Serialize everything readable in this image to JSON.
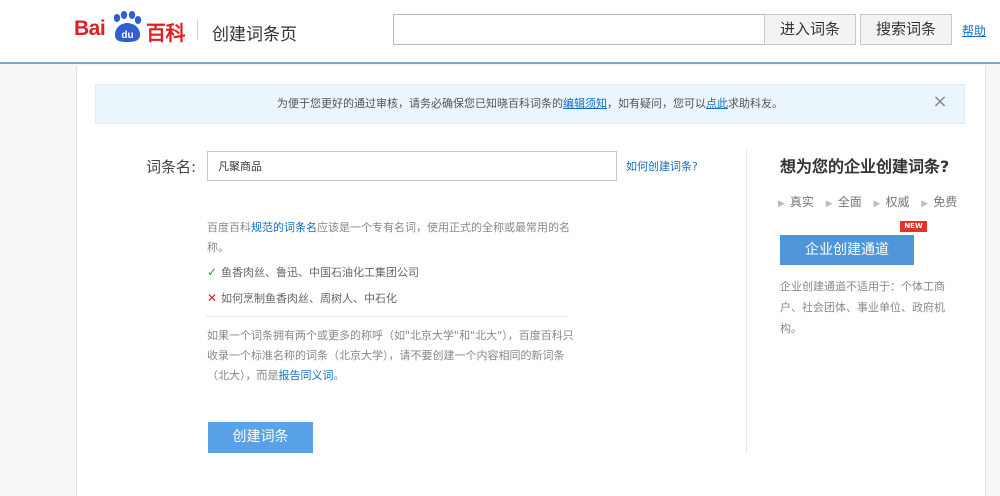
{
  "header": {
    "logo_left": "Bai",
    "logo_paw_text": "du",
    "logo_right": "百科",
    "page_title": "创建词条页",
    "search_value": "",
    "enter_button": "进入词条",
    "search_button": "搜索词条",
    "help_link": "帮助"
  },
  "notice": {
    "text_before": "为便于您更好的通过审核，请务必确保您已知晓百科词条的",
    "link1": "编辑须知",
    "text_middle": "，如有疑问，您可以",
    "link2": "点此",
    "text_after": "求助科友。",
    "close_icon": "×"
  },
  "form": {
    "name_label": "词条名:",
    "name_value": "凡聚商品",
    "how_link": "如何创建词条?",
    "guide1_before": "百度百科",
    "guide1_link": "规范的词条名",
    "guide1_after": "应该是一个专有名词，使用正式的全称或最常用的名称。",
    "example_ok_mark": "✓",
    "example_ok": "鱼香肉丝、鲁迅、中国石油化工集团公司",
    "example_bad_mark": "✕",
    "example_bad": "如何烹制鱼香肉丝、周树人、中石化",
    "guide2_text": "如果一个词条拥有两个或更多的称呼（如\"北京大学\"和\"北大\"），百度百科只收录一个标准名称的词条（北京大学），请不要创建一个内容相同的新词条（北大），而是",
    "guide2_link": "报告同义词",
    "guide2_end": "。",
    "create_button": "创建词条"
  },
  "sidebar": {
    "title": "想为您的企业创建词条?",
    "features": [
      "真实",
      "全面",
      "权威",
      "免费"
    ],
    "feature_arrow": "▶",
    "corp_button": "企业创建通道",
    "new_badge": "NEW",
    "description": "企业创建通道不适用于：个体工商户、社会团体、事业单位、政府机构。"
  },
  "colors": {
    "brand_red": "#e02020",
    "brand_blue": "#2f5fd1",
    "link_blue": "#136ec2",
    "button_blue": "#5aa2e7"
  }
}
